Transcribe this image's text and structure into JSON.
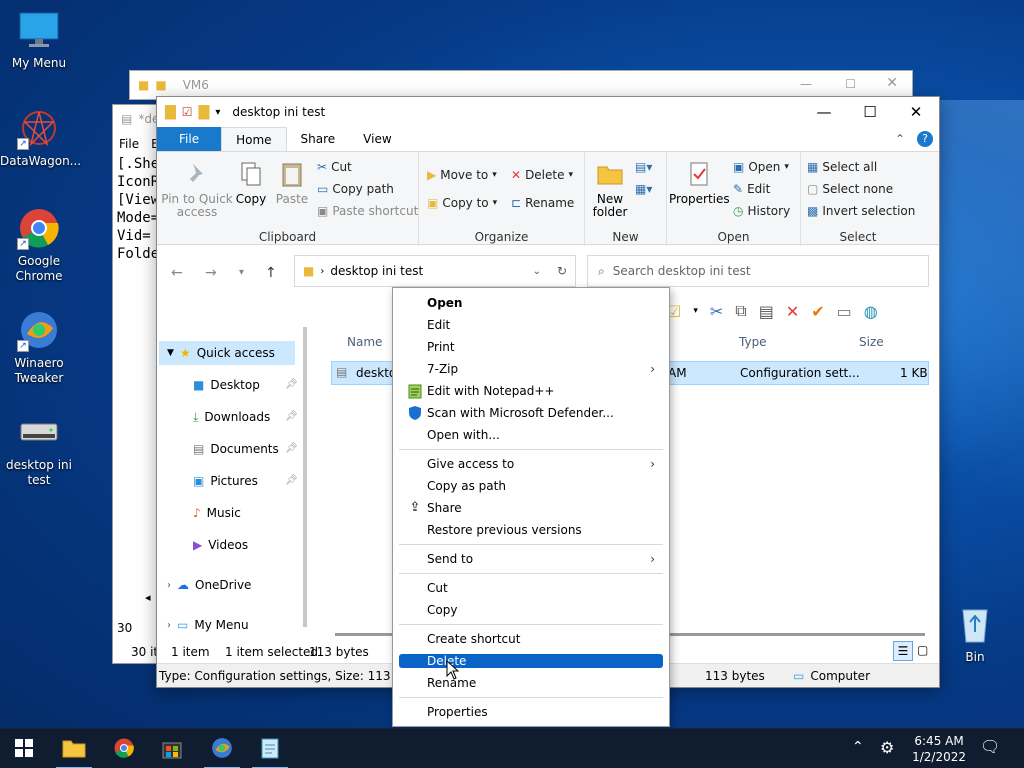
{
  "desktop": {
    "icons": [
      {
        "label": "My Menu"
      },
      {
        "label": "DataWagon..."
      },
      {
        "label": "Google Chrome"
      },
      {
        "label": "Winaero Tweaker"
      },
      {
        "label": "desktop ini test"
      },
      {
        "label": "Bin"
      }
    ]
  },
  "notepad": {
    "title": "*de",
    "menu_file": "File",
    "menu_edit": "E",
    "lines": [
      "[.She",
      "IconR",
      "[View",
      "Mode=",
      "Vid=",
      "Folde"
    ],
    "status1": "30",
    "status2": "30 it"
  },
  "back_window": {
    "title": "VM6"
  },
  "explorer": {
    "title": "desktop ini test",
    "tabs": {
      "file": "File",
      "home": "Home",
      "share": "Share",
      "view": "View"
    },
    "ribbon": {
      "clipboard": {
        "label": "Clipboard",
        "pin": "Pin to Quick access",
        "copy": "Copy",
        "paste": "Paste",
        "cut": "Cut",
        "copy_path": "Copy path",
        "paste_shortcut": "Paste shortcut"
      },
      "organize": {
        "label": "Organize",
        "move_to": "Move to",
        "copy_to": "Copy to",
        "delete": "Delete",
        "rename": "Rename"
      },
      "new": {
        "label": "New",
        "new_folder": "New folder"
      },
      "open": {
        "label": "Open",
        "properties": "Properties",
        "open": "Open",
        "edit": "Edit",
        "history": "History"
      },
      "select": {
        "label": "Select",
        "select_all": "Select all",
        "select_none": "Select none",
        "invert": "Invert selection"
      }
    },
    "address": "desktop ini test",
    "search_placeholder": "Search desktop ini test",
    "nav": {
      "quick_access": "Quick access",
      "items": [
        "Desktop",
        "Downloads",
        "Documents",
        "Pictures",
        "Music",
        "Videos"
      ],
      "onedrive": "OneDrive",
      "mymenu": "My Menu"
    },
    "columns": {
      "name": "Name",
      "type": "Type",
      "size": "Size"
    },
    "file": {
      "name": "desktop",
      "date_tail": "AM",
      "type": "Configuration sett...",
      "size": "1 KB"
    },
    "status": {
      "count": "1 item",
      "selected": "1 item selected",
      "bytes": "113 bytes"
    },
    "details": {
      "text": "Type: Configuration settings, Size: 113 bytes,",
      "size": "113 bytes",
      "location": "Computer"
    }
  },
  "context_menu": {
    "items": [
      "Open",
      "Edit",
      "Print",
      "7-Zip",
      "Edit with Notepad++",
      "Scan with Microsoft Defender...",
      "Open with...",
      "Give access to",
      "Copy as path",
      "Share",
      "Restore previous versions",
      "Send to",
      "Cut",
      "Copy",
      "Create shortcut",
      "Delete",
      "Rename",
      "Properties"
    ]
  },
  "taskbar": {
    "time": "6:45 AM",
    "date": "1/2/2022"
  },
  "colors": {
    "accent": "#0a64c8",
    "file_tab": "#1979ca",
    "selection": "#cce8ff",
    "taskbar": "#101d30"
  }
}
